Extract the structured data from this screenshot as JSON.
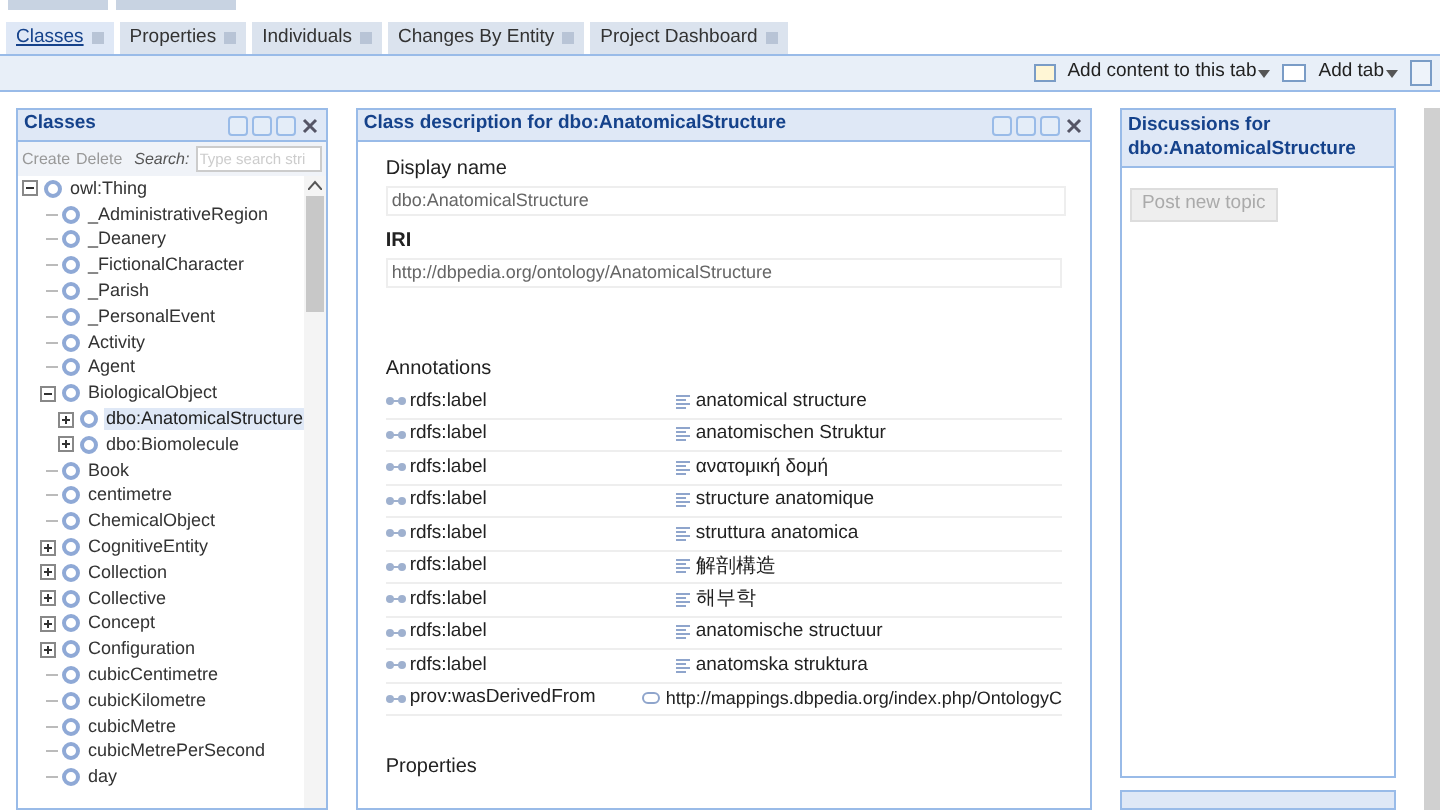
{
  "tabs": [
    {
      "label": "Classes",
      "selected": true
    },
    {
      "label": "Properties",
      "selected": false
    },
    {
      "label": "Individuals",
      "selected": false
    },
    {
      "label": "Changes By Entity",
      "selected": false
    },
    {
      "label": "Project Dashboard",
      "selected": false
    }
  ],
  "toolbar": {
    "add_content": "Add content to this tab",
    "add_tab": "Add tab"
  },
  "classes_panel": {
    "title": "Classes",
    "actions": [
      "Create",
      "Delete"
    ],
    "search_label": "Search:",
    "search": {
      "placeholder": "Type search stri"
    },
    "tree": [
      {
        "label": "owl:Thing",
        "expanded": true,
        "selected": false,
        "children": [
          {
            "label": "_AdministrativeRegion",
            "selected": false
          },
          {
            "label": "_Deanery",
            "selected": false
          },
          {
            "label": "_FictionalCharacter",
            "selected": false
          },
          {
            "label": "_Parish",
            "selected": false
          },
          {
            "label": "_PersonalEvent",
            "selected": false
          },
          {
            "label": "Activity",
            "selected": false
          },
          {
            "label": "Agent",
            "selected": false
          },
          {
            "label": "BiologicalObject",
            "expanded": true,
            "selected": false,
            "children": [
              {
                "label": "dbo:AnatomicalStructure",
                "expanded": false,
                "selected": true
              },
              {
                "label": "dbo:Biomolecule",
                "expanded": false,
                "selected": false
              }
            ]
          },
          {
            "label": "Book",
            "selected": false
          },
          {
            "label": "centimetre",
            "selected": false
          },
          {
            "label": "ChemicalObject",
            "selected": false
          },
          {
            "label": "CognitiveEntity",
            "expanded": false,
            "selected": false
          },
          {
            "label": "Collection",
            "expanded": false,
            "selected": false
          },
          {
            "label": "Collective",
            "expanded": false,
            "selected": false
          },
          {
            "label": "Concept",
            "expanded": false,
            "selected": false
          },
          {
            "label": "Configuration",
            "expanded": false,
            "selected": false
          },
          {
            "label": "cubicCentimetre",
            "selected": false
          },
          {
            "label": "cubicKilometre",
            "selected": false
          },
          {
            "label": "cubicMetre",
            "selected": false
          },
          {
            "label": "cubicMetrePerSecond",
            "selected": false
          },
          {
            "label": "day",
            "selected": false
          }
        ]
      }
    ]
  },
  "description_panel": {
    "title": "Class description for dbo:AnatomicalStructure",
    "display_name": {
      "label": "Display name",
      "value": "dbo:AnatomicalStructure"
    },
    "iri": {
      "label": "IRI",
      "value": "http://dbpedia.org/ontology/AnatomicalStructure"
    },
    "annotations_heading": "Annotations",
    "annotations": [
      {
        "property": "rdfs:label",
        "value": "anatomical structure",
        "kind": "literal"
      },
      {
        "property": "rdfs:label",
        "value": "anatomischen Struktur",
        "kind": "literal"
      },
      {
        "property": "rdfs:label",
        "value": "ανατομική δομή",
        "kind": "literal"
      },
      {
        "property": "rdfs:label",
        "value": "structure anatomique",
        "kind": "literal"
      },
      {
        "property": "rdfs:label",
        "value": "struttura anatomica",
        "kind": "literal"
      },
      {
        "property": "rdfs:label",
        "value": "解剖構造",
        "kind": "literal"
      },
      {
        "property": "rdfs:label",
        "value": "해부학",
        "kind": "literal"
      },
      {
        "property": "rdfs:label",
        "value": "anatomische structuur",
        "kind": "literal"
      },
      {
        "property": "rdfs:label",
        "value": "anatomska struktura",
        "kind": "literal"
      },
      {
        "property": "prov:wasDerivedFrom",
        "value": "http://mappings.dbpedia.org/index.php/OntologyC",
        "kind": "link"
      }
    ],
    "properties_heading": "Properties"
  },
  "discussions_panel": {
    "title": "Discussions for dbo:AnatomicalStructure",
    "post_button": {
      "label": "Post new topic",
      "disabled": true
    }
  }
}
